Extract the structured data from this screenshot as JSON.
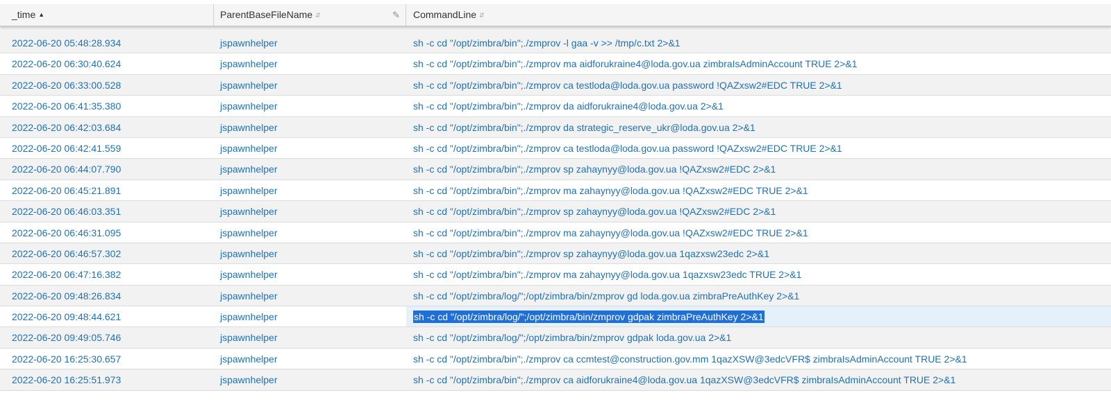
{
  "columns": {
    "time": "_time",
    "parent": "ParentBaseFileName",
    "cmd": "CommandLine"
  },
  "rows": [
    {
      "time": "2022-06-20 05:48:28.934",
      "parent": "jspawnhelper",
      "cmd": "sh -c cd \"/opt/zimbra/bin\";./zmprov -l gaa -v >> /tmp/c.txt 2>&1"
    },
    {
      "time": "2022-06-20 06:30:40.624",
      "parent": "jspawnhelper",
      "cmd": "sh -c cd \"/opt/zimbra/bin\";./zmprov ma aidforukraine4@loda.gov.ua zimbraIsAdminAccount TRUE 2>&1"
    },
    {
      "time": "2022-06-20 06:33:00.528",
      "parent": "jspawnhelper",
      "cmd": "sh -c cd \"/opt/zimbra/bin\";./zmprov ca testloda@loda.gov.ua password !QAZxsw2#EDC TRUE 2>&1"
    },
    {
      "time": "2022-06-20 06:41:35.380",
      "parent": "jspawnhelper",
      "cmd": "sh -c cd \"/opt/zimbra/bin\";./zmprov da aidforukraine4@loda.gov.ua 2>&1"
    },
    {
      "time": "2022-06-20 06:42:03.684",
      "parent": "jspawnhelper",
      "cmd": "sh -c cd \"/opt/zimbra/bin\";./zmprov da strategic_reserve_ukr@loda.gov.ua 2>&1"
    },
    {
      "time": "2022-06-20 06:42:41.559",
      "parent": "jspawnhelper",
      "cmd": "sh -c cd \"/opt/zimbra/bin\";./zmprov ca testloda@loda.gov.ua password !QAZxsw2#EDC TRUE 2>&1"
    },
    {
      "time": "2022-06-20 06:44:07.790",
      "parent": "jspawnhelper",
      "cmd": "sh -c cd \"/opt/zimbra/bin\";./zmprov sp zahaynyy@loda.gov.ua !QAZxsw2#EDC 2>&1"
    },
    {
      "time": "2022-06-20 06:45:21.891",
      "parent": "jspawnhelper",
      "cmd": "sh -c cd \"/opt/zimbra/bin\";./zmprov ma zahaynyy@loda.gov.ua !QAZxsw2#EDC TRUE 2>&1"
    },
    {
      "time": "2022-06-20 06:46:03.351",
      "parent": "jspawnhelper",
      "cmd": "sh -c cd \"/opt/zimbra/bin\";./zmprov sp zahaynyy@loda.gov.ua !QAZxsw2#EDC 2>&1"
    },
    {
      "time": "2022-06-20 06:46:31.095",
      "parent": "jspawnhelper",
      "cmd": "sh -c cd \"/opt/zimbra/bin\";./zmprov ma zahaynyy@loda.gov.ua !QAZxsw2#EDC TRUE 2>&1"
    },
    {
      "time": "2022-06-20 06:46:57.302",
      "parent": "jspawnhelper",
      "cmd": "sh -c cd \"/opt/zimbra/bin\";./zmprov sp zahaynyy@loda.gov.ua 1qazxsw23edc 2>&1"
    },
    {
      "time": "2022-06-20 06:47:16.382",
      "parent": "jspawnhelper",
      "cmd": "sh -c cd \"/opt/zimbra/bin\";./zmprov ma zahaynyy@loda.gov.ua 1qazxsw23edc TRUE 2>&1"
    },
    {
      "time": "2022-06-20 09:48:26.834",
      "parent": "jspawnhelper",
      "cmd": "sh -c cd \"/opt/zimbra/log/\";/opt/zimbra/bin/zmprov gd loda.gov.ua zimbraPreAuthKey 2>&1"
    },
    {
      "time": "2022-06-20 09:48:44.621",
      "parent": "jspawnhelper",
      "cmd": "sh -c cd \"/opt/zimbra/log/\";/opt/zimbra/bin/zmprov gdpak zimbraPreAuthKey 2>&1"
    },
    {
      "time": "2022-06-20 09:49:05.746",
      "parent": "jspawnhelper",
      "cmd": "sh -c cd \"/opt/zimbra/log/\";/opt/zimbra/bin/zmprov gdpak loda.gov.ua 2>&1"
    },
    {
      "time": "2022-06-20 16:25:30.657",
      "parent": "jspawnhelper",
      "cmd": "sh -c cd \"/opt/zimbra/bin\";./zmprov ca ccmtest@construction.gov.mm 1qazXSW@3edcVFR$ zimbraIsAdminAccount TRUE 2>&1"
    },
    {
      "time": "2022-06-20 16:25:51.973",
      "parent": "jspawnhelper",
      "cmd": "sh -c cd \"/opt/zimbra/bin\";./zmprov ca aidforukraine4@loda.gov.ua 1qazXSW@3edcVFR$ zimbraIsAdminAccount TRUE 2>&1"
    }
  ],
  "selected_row": 13,
  "colors": {
    "link": "#1f71b5",
    "selection": "#1f6fd6",
    "row_alt": "#f2f2f2"
  }
}
